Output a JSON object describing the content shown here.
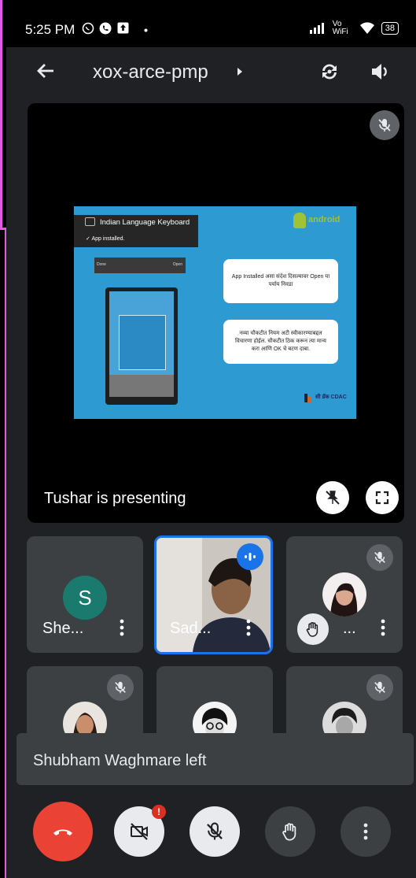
{
  "status": {
    "time": "5:25 PM",
    "network": "Vo WiFi",
    "battery": "38",
    "icons": [
      "whatsapp-icon",
      "call-icon",
      "upload-icon",
      "dot-icon",
      "signal-icon",
      "wifi-icon",
      "battery-icon"
    ]
  },
  "header": {
    "meeting_code": "xox-arce-pmp",
    "icons": [
      "back-arrow-icon",
      "caret-right-icon",
      "switch-camera-icon",
      "speaker-icon"
    ]
  },
  "stage": {
    "presenter_text": "Tushar is presenting",
    "slide": {
      "keyboard_title": "Indian Language Keyboard",
      "app_installed": "App installed.",
      "dialog_done": "Done",
      "dialog_open": "Open",
      "android_label": "android",
      "callout1": "App Installed असा संदेश दिसल्यावर Open या पर्याय निवडा",
      "callout2": "नव्या चौकटीत नियम अटी स्वीकारण्याबद्दल विचारणा होईल. चौकटीत ठिक करून त्या मान्य करा आणि OK चे बटण दाबा.",
      "logo_text": "सी डॅक CDAC"
    },
    "icons": [
      "mic-off-icon",
      "unpin-icon",
      "fullscreen-icon"
    ]
  },
  "participants": [
    {
      "name": "She...",
      "avatar_letter": "S",
      "muted": false
    },
    {
      "name": "Sad...",
      "speaking": true
    },
    {
      "name": "...",
      "muted": true,
      "hand_raised": true
    },
    {
      "name": "",
      "muted": true
    },
    {
      "name": "",
      "muted": false
    },
    {
      "name": "",
      "muted": true
    }
  ],
  "toast": {
    "message": "Shubham Waghmare left"
  },
  "controls": {
    "badge": "!",
    "buttons": [
      "end-call",
      "camera-off",
      "mic-off",
      "raise-hand",
      "more-options"
    ]
  },
  "colors": {
    "background": "#202124",
    "tile": "#3c4043",
    "accent_blue": "#1a73e8",
    "end_call_red": "#ea4335",
    "avatar_teal": "#1a7a6e",
    "slide_blue": "#2e9ad2",
    "frame_pink": "#e458e8"
  }
}
